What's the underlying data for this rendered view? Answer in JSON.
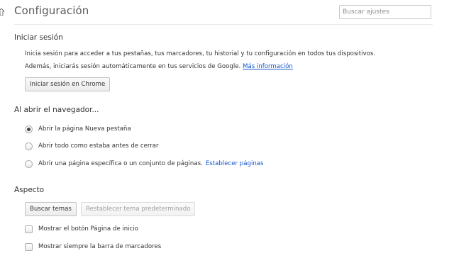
{
  "header": {
    "title": "Configuración",
    "search_placeholder": "Buscar ajustes"
  },
  "signin": {
    "title": "Iniciar sesión",
    "line1": "Inicia sesión para acceder a tus pestañas, tus marcadores, tu historial y tu configuración en todos tus dispositivos.",
    "line2": "Además, iniciarás sesión automáticamente en tus servicios de Google.",
    "more_info_link": "Más información",
    "button": "Iniciar sesión en Chrome"
  },
  "startup": {
    "title": "Al abrir el navegador...",
    "options": [
      {
        "label": "Abrir la página Nueva pestaña",
        "selected": true
      },
      {
        "label": "Abrir todo como estaba antes de cerrar",
        "selected": false
      },
      {
        "label": "Abrir una página específica o un conjunto de páginas.",
        "selected": false
      }
    ],
    "set_pages_link": "Establecer páginas"
  },
  "appearance": {
    "title": "Aspecto",
    "themes_button": "Buscar temas",
    "reset_theme_button": "Restablecer tema predeterminado",
    "checkboxes": [
      {
        "label": "Mostrar el botón Página de inicio",
        "checked": false
      },
      {
        "label": "Mostrar siempre la barra de marcadores",
        "checked": false
      }
    ]
  }
}
